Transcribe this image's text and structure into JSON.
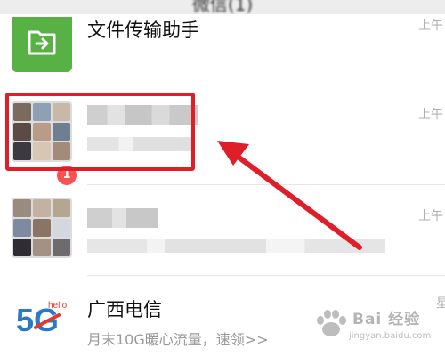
{
  "header": {
    "title": "微信(1)"
  },
  "chats": [
    {
      "id": "file-transfer",
      "name": "文件传输助手",
      "time": "上午"
    },
    {
      "id": "group-1",
      "time": "上午"
    },
    {
      "id": "group-2",
      "time": "上午",
      "unread": "1"
    },
    {
      "id": "telecom",
      "name": "广西电信",
      "message": "月末10G暖心流量，速领>>",
      "time": "星"
    }
  ],
  "logo": {
    "text": "5G",
    "sub": "hello"
  },
  "watermark": {
    "brand": "Bai 经验",
    "url": "jingyan.baidu.com"
  },
  "colors": {
    "file_icon": "#57b144",
    "highlight": "#e01e29",
    "badge": "#fa5151",
    "arrow": "#e01e29"
  }
}
